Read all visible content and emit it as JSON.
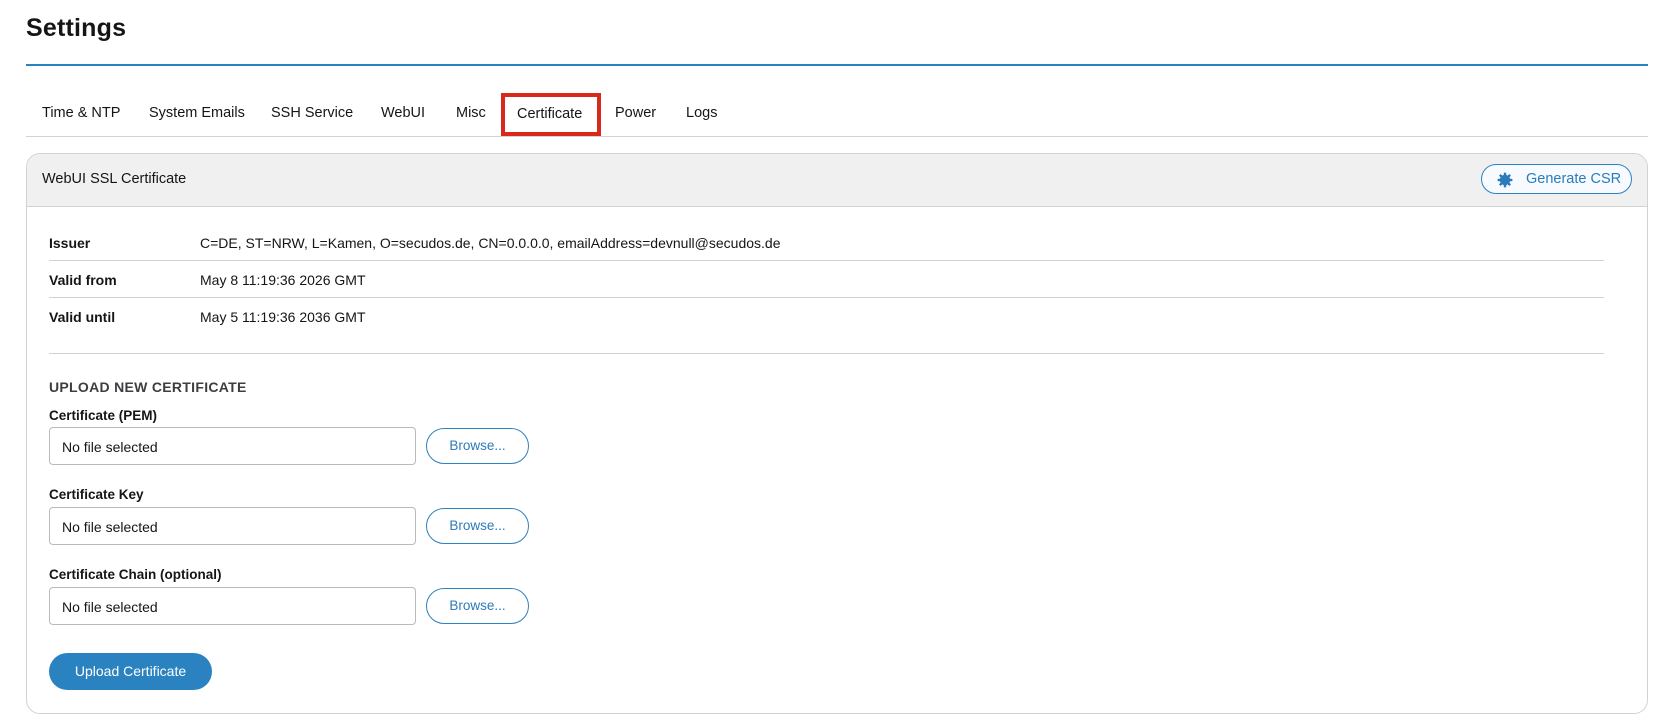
{
  "page": {
    "title": "Settings"
  },
  "tabs": [
    {
      "label": "Time & NTP"
    },
    {
      "label": "System Emails"
    },
    {
      "label": "SSH Service"
    },
    {
      "label": "WebUI"
    },
    {
      "label": "Misc"
    },
    {
      "label": "Certificate",
      "active": true
    },
    {
      "label": "Power"
    },
    {
      "label": "Logs"
    }
  ],
  "panel": {
    "title": "WebUI SSL Certificate",
    "generate_csr_label": "Generate CSR",
    "generate_csr_icon": "gear-icon",
    "accent_color": "#2b82c1",
    "highlight_color": "#d9291c"
  },
  "cert_info": [
    {
      "key": "Issuer",
      "value": "C=DE, ST=NRW, L=Kamen, O=secudos.de, CN=0.0.0.0, emailAddress=devnull@secudos.de"
    },
    {
      "key": "Valid from",
      "value": "May 8 11:19:36 2026 GMT"
    },
    {
      "key": "Valid until",
      "value": "May 5 11:19:36 2036 GMT"
    }
  ],
  "upload": {
    "section_title": "UPLOAD NEW CERTIFICATE",
    "fields": [
      {
        "label": "Certificate (PEM)",
        "value": "No file selected",
        "button": "Browse..."
      },
      {
        "label": "Certificate Key",
        "value": "No file selected",
        "button": "Browse..."
      },
      {
        "label": "Certificate Chain (optional)",
        "value": "No file selected",
        "button": "Browse..."
      }
    ],
    "submit_label": "Upload Certificate"
  }
}
